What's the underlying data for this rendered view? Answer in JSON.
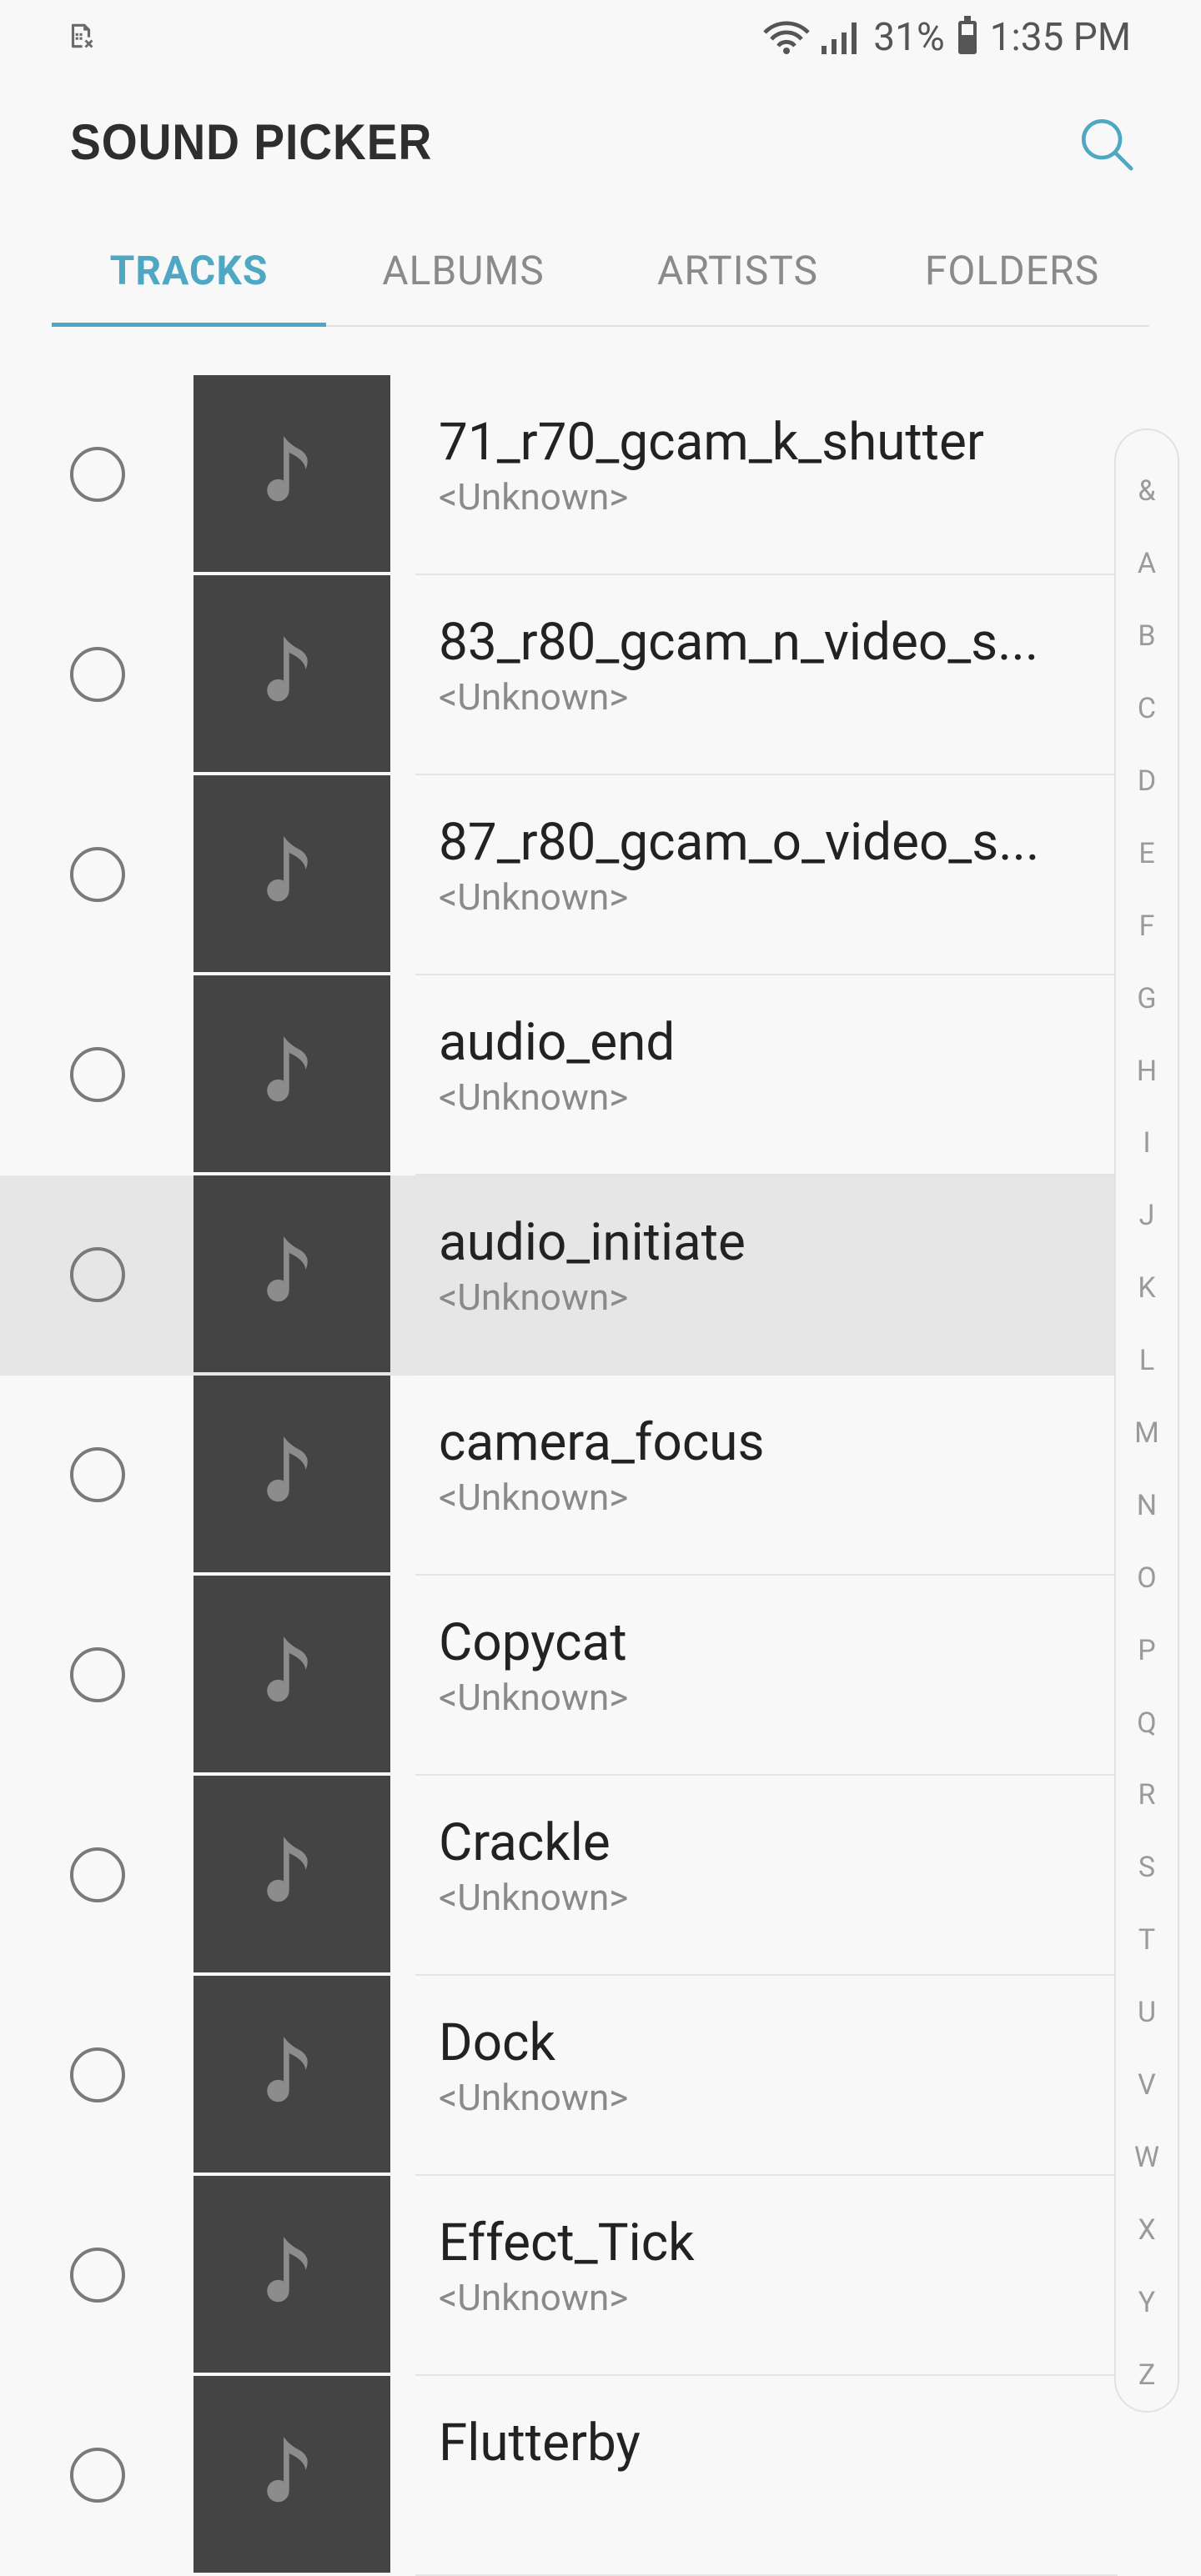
{
  "status_bar": {
    "battery": "31%",
    "time": "1:35 PM",
    "battery_level": 0.31
  },
  "header": {
    "title": "SOUND PICKER"
  },
  "tabs": [
    {
      "label": "TRACKS",
      "active": true
    },
    {
      "label": "ALBUMS",
      "active": false
    },
    {
      "label": "ARTISTS",
      "active": false
    },
    {
      "label": "FOLDERS",
      "active": false
    }
  ],
  "tracks": [
    {
      "name": "71_r70_gcam_k_shutter",
      "artist": "<Unknown>",
      "highlighted": false
    },
    {
      "name": "83_r80_gcam_n_video_s...",
      "artist": "<Unknown>",
      "highlighted": false
    },
    {
      "name": "87_r80_gcam_o_video_s...",
      "artist": "<Unknown>",
      "highlighted": false
    },
    {
      "name": "audio_end",
      "artist": "<Unknown>",
      "highlighted": false
    },
    {
      "name": "audio_initiate",
      "artist": "<Unknown>",
      "highlighted": true
    },
    {
      "name": "camera_focus",
      "artist": "<Unknown>",
      "highlighted": false
    },
    {
      "name": "Copycat",
      "artist": "<Unknown>",
      "highlighted": false
    },
    {
      "name": "Crackle",
      "artist": "<Unknown>",
      "highlighted": false
    },
    {
      "name": "Dock",
      "artist": "<Unknown>",
      "highlighted": false
    },
    {
      "name": "Effect_Tick",
      "artist": "<Unknown>",
      "highlighted": false
    },
    {
      "name": "Flutterby",
      "artist": "",
      "highlighted": false
    }
  ],
  "index_letters": [
    "&",
    "A",
    "B",
    "C",
    "D",
    "E",
    "F",
    "G",
    "H",
    "I",
    "J",
    "K",
    "L",
    "M",
    "N",
    "O",
    "P",
    "Q",
    "R",
    "S",
    "T",
    "U",
    "V",
    "W",
    "X",
    "Y",
    "Z"
  ],
  "colors": {
    "accent": "#4ea8c3",
    "background": "#f8f8f8",
    "thumbnail": "#444444",
    "highlight": "#e6e6e6"
  }
}
